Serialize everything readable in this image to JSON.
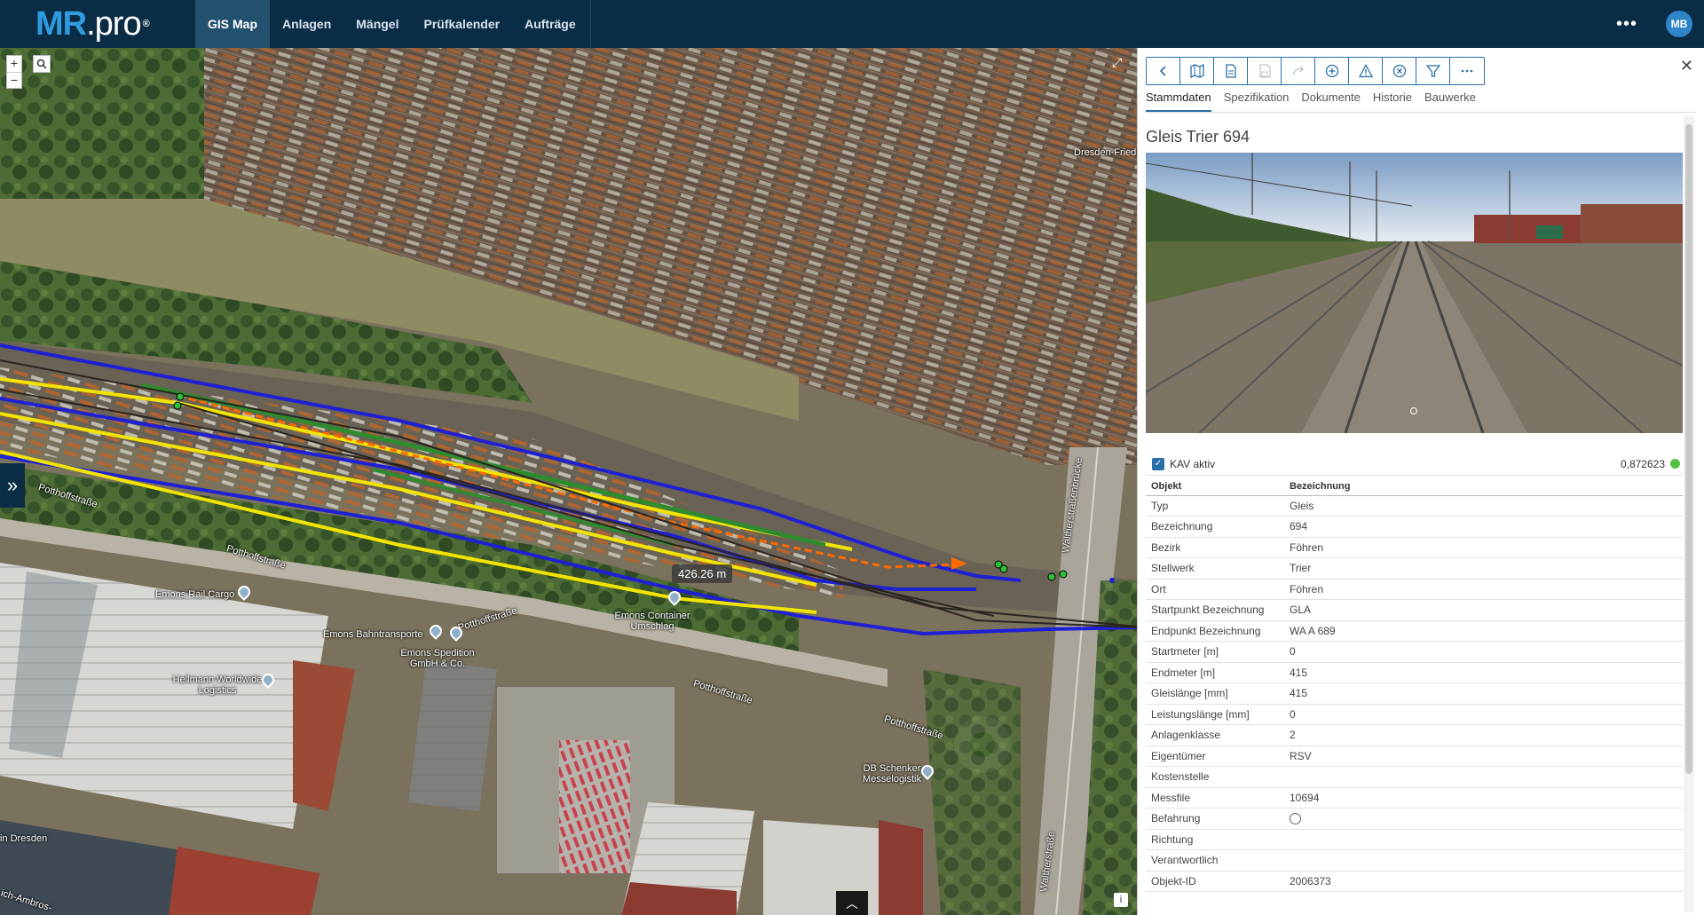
{
  "app": {
    "logo_main": "MR",
    "logo_suffix": ".pro",
    "logo_reg": "®",
    "avatar_initials": "MB"
  },
  "nav": [
    {
      "label": "GIS Map",
      "active": true
    },
    {
      "label": "Anlagen"
    },
    {
      "label": "Mängel"
    },
    {
      "label": "Prüfkalender"
    },
    {
      "label": "Aufträge"
    }
  ],
  "map": {
    "measure_label": "426.26 m",
    "labels": [
      "Potthoffstraße",
      "Potthoffstraße",
      "Potthoffstraße",
      "Potthoffstraße",
      "Potthoffstraße",
      "Emons Rail Cargo",
      "Emons Bahntransporte",
      "Emons Spedition GmbH & Co.",
      "Hellmann Worldwide Logistics",
      "Emons Container Umschlag",
      "DB Schenker Messelogistik",
      "Waltherstraßenbrücke",
      "Waltherstraße",
      "Dresden-Fried",
      "in Dresden",
      "ich-Ambros-"
    ]
  },
  "panel": {
    "tabs": [
      "Stammdaten",
      "Spezifikation",
      "Dokumente",
      "Historie",
      "Bauwerke"
    ],
    "title": "Gleis Trier 694",
    "kav_label": "KAV aktiv",
    "kav_value": "0,872623",
    "table_header": [
      "Objekt",
      "Bezeichnung"
    ],
    "rows": [
      {
        "key": "Typ",
        "value": "Gleis"
      },
      {
        "key": "Bezeichnung",
        "value": "694"
      },
      {
        "key": "Bezirk",
        "value": "Föhren"
      },
      {
        "key": "Stellwerk",
        "value": "Trier"
      },
      {
        "key": "Ort",
        "value": "Föhren"
      },
      {
        "key": "Startpunkt Bezeichnung",
        "value": "GLA"
      },
      {
        "key": "Endpunkt Bezeichnung",
        "value": "WA A 689"
      },
      {
        "key": "Startmeter [m]",
        "value": "0"
      },
      {
        "key": "Endmeter [m]",
        "value": "415"
      },
      {
        "key": "Gleislänge [mm]",
        "value": "415"
      },
      {
        "key": "Leistungslänge [mm]",
        "value": "0"
      },
      {
        "key": "Anlagenklasse",
        "value": "2"
      },
      {
        "key": "Eigentümer",
        "value": "RSV"
      },
      {
        "key": "Kostenstelle",
        "value": ""
      },
      {
        "key": "Messfile",
        "value": "10694"
      },
      {
        "key": "Befahrung",
        "value": ""
      },
      {
        "key": "Richtung",
        "value": ""
      },
      {
        "key": "Verantwortlich",
        "value": ""
      },
      {
        "key": "Objekt-ID",
        "value": "2006373"
      }
    ]
  },
  "colors": {
    "topbar": "#0b2c45",
    "accent": "#2a6ea8",
    "track_blue": "#1f1fd6",
    "track_yellow": "#f2e400",
    "track_green": "#2e8b2e",
    "track_orange": "#ff6a00"
  }
}
